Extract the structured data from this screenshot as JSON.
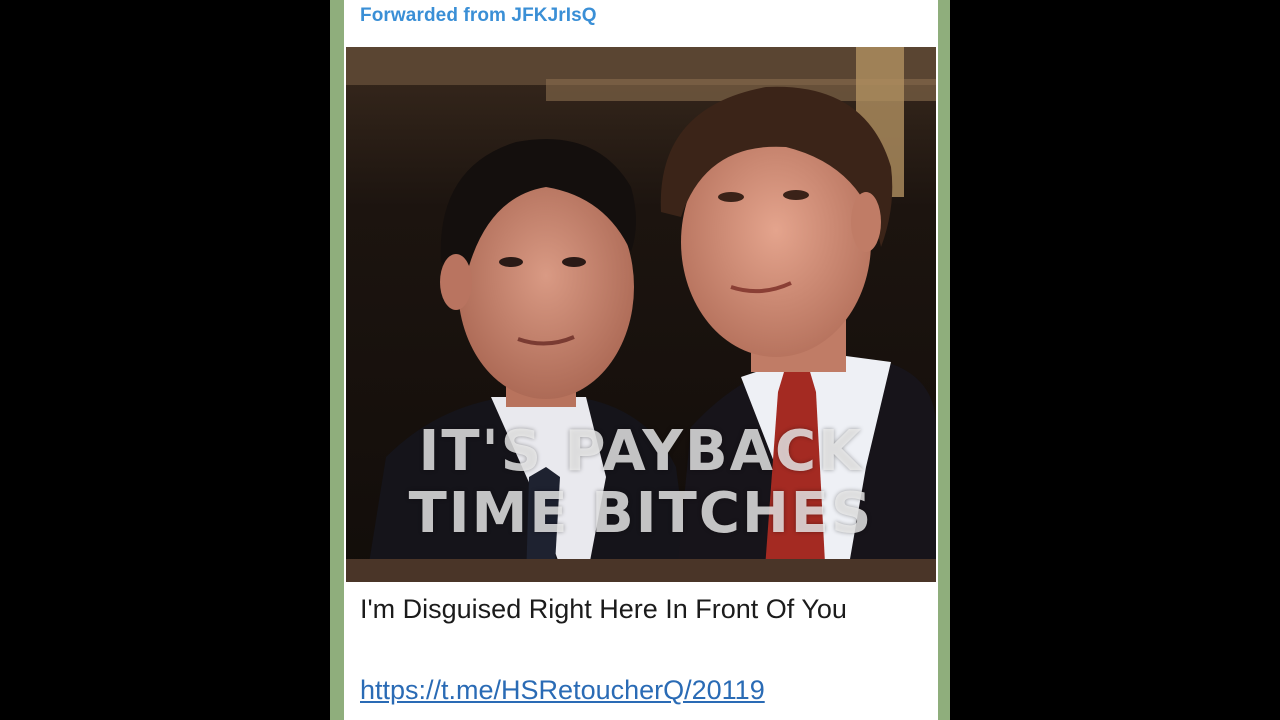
{
  "message": {
    "forwarded_from": "Forwarded from JFKJrIsQ",
    "image": {
      "alt": "Photo meme of two men in suits",
      "overlay_line1": "IT'S PAYBACK",
      "overlay_line2": "TIME BITCHES"
    },
    "caption": "I'm Disguised Right Here In Front Of You",
    "link": "https://t.me/HSRetoucherQ/20119"
  },
  "colors": {
    "background": "#000000",
    "chat_wallpaper": "#8fae7c",
    "bubble": "#ffffff",
    "forwarded_accent": "#3a8fd6",
    "link": "#2a6bb5"
  }
}
